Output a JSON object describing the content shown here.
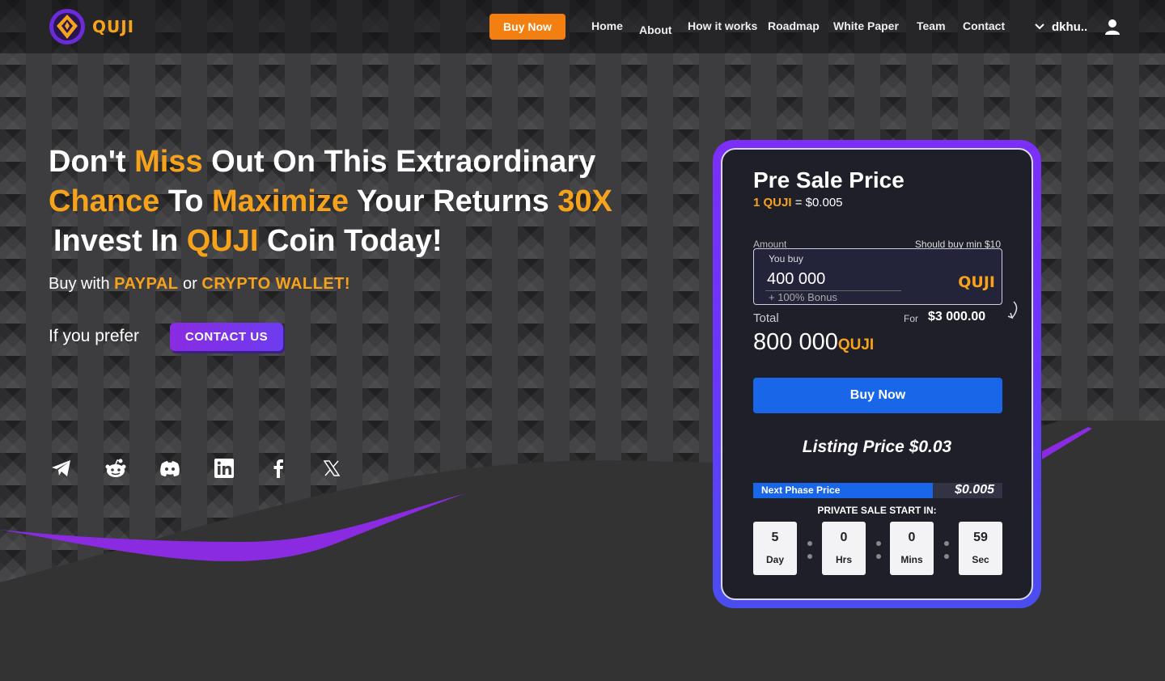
{
  "brand": {
    "name": "QUJI"
  },
  "colors": {
    "accent": "#f7a21b",
    "primary": "#1a66e8",
    "purple": "#8a2be2",
    "header_buy": "#f27f10"
  },
  "header": {
    "buy_label": "Buy Now",
    "nav": [
      "Home",
      "About",
      "How it works",
      "Roadmap",
      "White Paper",
      "Team",
      "Contact"
    ],
    "user_name": "dkhu.."
  },
  "hero": {
    "line1_a": "Don't ",
    "line1_b": "Miss",
    "line1_c": " Out On This Extraordinary",
    "line2_a": "Chance",
    "line2_b": " To ",
    "line2_c": "Maximize",
    "line2_d": " Your Returns ",
    "line2_e": "30X",
    "line3_a": " Invest In ",
    "line3_b": "QUJI",
    "line3_c": " Coin Today!",
    "buy_with": "Buy with ",
    "paypal": "PAYPAL",
    "or": " or ",
    "crypto": "CRYPTO WALLET!",
    "prefer": "If you prefer",
    "contact_btn": "CONTACT US"
  },
  "social_icons": [
    "telegram-icon",
    "reddit-icon",
    "discord-icon",
    "linkedin-icon",
    "facebook-icon",
    "x-icon"
  ],
  "card": {
    "title": "Pre Sale Price",
    "rate_token": "1 QUJI",
    "rate_value": " = $0.005",
    "amount_label": "Amount",
    "min_label": "Should buy min $10",
    "you_buy_label": "You buy",
    "you_buy_value": "400 000",
    "bonus": "+ 100% Bonus",
    "token": "QUJI",
    "total_label": "Total",
    "for_label": "For",
    "for_value": "$3 000.00",
    "total_value": "800 000",
    "buy_label": "Buy Now",
    "listing_label": "Listing Price  $0.03",
    "next_phase_label": "Next Phase Price",
    "next_phase_value": "$0.005",
    "next_phase_progress": 0.72,
    "private_sale_label": "PRIVATE SALE START IN:",
    "countdown": [
      {
        "value": "5",
        "unit": "Day"
      },
      {
        "value": "0",
        "unit": "Hrs"
      },
      {
        "value": "0",
        "unit": "Mins"
      },
      {
        "value": "59",
        "unit": "Sec"
      }
    ]
  }
}
